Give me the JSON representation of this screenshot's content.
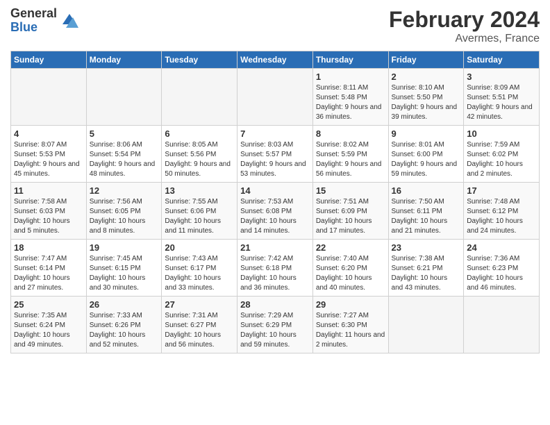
{
  "header": {
    "logo_general": "General",
    "logo_blue": "Blue",
    "title": "February 2024",
    "subtitle": "Avermes, France"
  },
  "days_of_week": [
    "Sunday",
    "Monday",
    "Tuesday",
    "Wednesday",
    "Thursday",
    "Friday",
    "Saturday"
  ],
  "weeks": [
    [
      {
        "day": "",
        "info": ""
      },
      {
        "day": "",
        "info": ""
      },
      {
        "day": "",
        "info": ""
      },
      {
        "day": "",
        "info": ""
      },
      {
        "day": "1",
        "sunrise": "Sunrise: 8:11 AM",
        "sunset": "Sunset: 5:48 PM",
        "daylight": "Daylight: 9 hours and 36 minutes."
      },
      {
        "day": "2",
        "sunrise": "Sunrise: 8:10 AM",
        "sunset": "Sunset: 5:50 PM",
        "daylight": "Daylight: 9 hours and 39 minutes."
      },
      {
        "day": "3",
        "sunrise": "Sunrise: 8:09 AM",
        "sunset": "Sunset: 5:51 PM",
        "daylight": "Daylight: 9 hours and 42 minutes."
      }
    ],
    [
      {
        "day": "4",
        "sunrise": "Sunrise: 8:07 AM",
        "sunset": "Sunset: 5:53 PM",
        "daylight": "Daylight: 9 hours and 45 minutes."
      },
      {
        "day": "5",
        "sunrise": "Sunrise: 8:06 AM",
        "sunset": "Sunset: 5:54 PM",
        "daylight": "Daylight: 9 hours and 48 minutes."
      },
      {
        "day": "6",
        "sunrise": "Sunrise: 8:05 AM",
        "sunset": "Sunset: 5:56 PM",
        "daylight": "Daylight: 9 hours and 50 minutes."
      },
      {
        "day": "7",
        "sunrise": "Sunrise: 8:03 AM",
        "sunset": "Sunset: 5:57 PM",
        "daylight": "Daylight: 9 hours and 53 minutes."
      },
      {
        "day": "8",
        "sunrise": "Sunrise: 8:02 AM",
        "sunset": "Sunset: 5:59 PM",
        "daylight": "Daylight: 9 hours and 56 minutes."
      },
      {
        "day": "9",
        "sunrise": "Sunrise: 8:01 AM",
        "sunset": "Sunset: 6:00 PM",
        "daylight": "Daylight: 9 hours and 59 minutes."
      },
      {
        "day": "10",
        "sunrise": "Sunrise: 7:59 AM",
        "sunset": "Sunset: 6:02 PM",
        "daylight": "Daylight: 10 hours and 2 minutes."
      }
    ],
    [
      {
        "day": "11",
        "sunrise": "Sunrise: 7:58 AM",
        "sunset": "Sunset: 6:03 PM",
        "daylight": "Daylight: 10 hours and 5 minutes."
      },
      {
        "day": "12",
        "sunrise": "Sunrise: 7:56 AM",
        "sunset": "Sunset: 6:05 PM",
        "daylight": "Daylight: 10 hours and 8 minutes."
      },
      {
        "day": "13",
        "sunrise": "Sunrise: 7:55 AM",
        "sunset": "Sunset: 6:06 PM",
        "daylight": "Daylight: 10 hours and 11 minutes."
      },
      {
        "day": "14",
        "sunrise": "Sunrise: 7:53 AM",
        "sunset": "Sunset: 6:08 PM",
        "daylight": "Daylight: 10 hours and 14 minutes."
      },
      {
        "day": "15",
        "sunrise": "Sunrise: 7:51 AM",
        "sunset": "Sunset: 6:09 PM",
        "daylight": "Daylight: 10 hours and 17 minutes."
      },
      {
        "day": "16",
        "sunrise": "Sunrise: 7:50 AM",
        "sunset": "Sunset: 6:11 PM",
        "daylight": "Daylight: 10 hours and 21 minutes."
      },
      {
        "day": "17",
        "sunrise": "Sunrise: 7:48 AM",
        "sunset": "Sunset: 6:12 PM",
        "daylight": "Daylight: 10 hours and 24 minutes."
      }
    ],
    [
      {
        "day": "18",
        "sunrise": "Sunrise: 7:47 AM",
        "sunset": "Sunset: 6:14 PM",
        "daylight": "Daylight: 10 hours and 27 minutes."
      },
      {
        "day": "19",
        "sunrise": "Sunrise: 7:45 AM",
        "sunset": "Sunset: 6:15 PM",
        "daylight": "Daylight: 10 hours and 30 minutes."
      },
      {
        "day": "20",
        "sunrise": "Sunrise: 7:43 AM",
        "sunset": "Sunset: 6:17 PM",
        "daylight": "Daylight: 10 hours and 33 minutes."
      },
      {
        "day": "21",
        "sunrise": "Sunrise: 7:42 AM",
        "sunset": "Sunset: 6:18 PM",
        "daylight": "Daylight: 10 hours and 36 minutes."
      },
      {
        "day": "22",
        "sunrise": "Sunrise: 7:40 AM",
        "sunset": "Sunset: 6:20 PM",
        "daylight": "Daylight: 10 hours and 40 minutes."
      },
      {
        "day": "23",
        "sunrise": "Sunrise: 7:38 AM",
        "sunset": "Sunset: 6:21 PM",
        "daylight": "Daylight: 10 hours and 43 minutes."
      },
      {
        "day": "24",
        "sunrise": "Sunrise: 7:36 AM",
        "sunset": "Sunset: 6:23 PM",
        "daylight": "Daylight: 10 hours and 46 minutes."
      }
    ],
    [
      {
        "day": "25",
        "sunrise": "Sunrise: 7:35 AM",
        "sunset": "Sunset: 6:24 PM",
        "daylight": "Daylight: 10 hours and 49 minutes."
      },
      {
        "day": "26",
        "sunrise": "Sunrise: 7:33 AM",
        "sunset": "Sunset: 6:26 PM",
        "daylight": "Daylight: 10 hours and 52 minutes."
      },
      {
        "day": "27",
        "sunrise": "Sunrise: 7:31 AM",
        "sunset": "Sunset: 6:27 PM",
        "daylight": "Daylight: 10 hours and 56 minutes."
      },
      {
        "day": "28",
        "sunrise": "Sunrise: 7:29 AM",
        "sunset": "Sunset: 6:29 PM",
        "daylight": "Daylight: 10 hours and 59 minutes."
      },
      {
        "day": "29",
        "sunrise": "Sunrise: 7:27 AM",
        "sunset": "Sunset: 6:30 PM",
        "daylight": "Daylight: 11 hours and 2 minutes."
      },
      {
        "day": "",
        "info": ""
      },
      {
        "day": "",
        "info": ""
      }
    ]
  ]
}
